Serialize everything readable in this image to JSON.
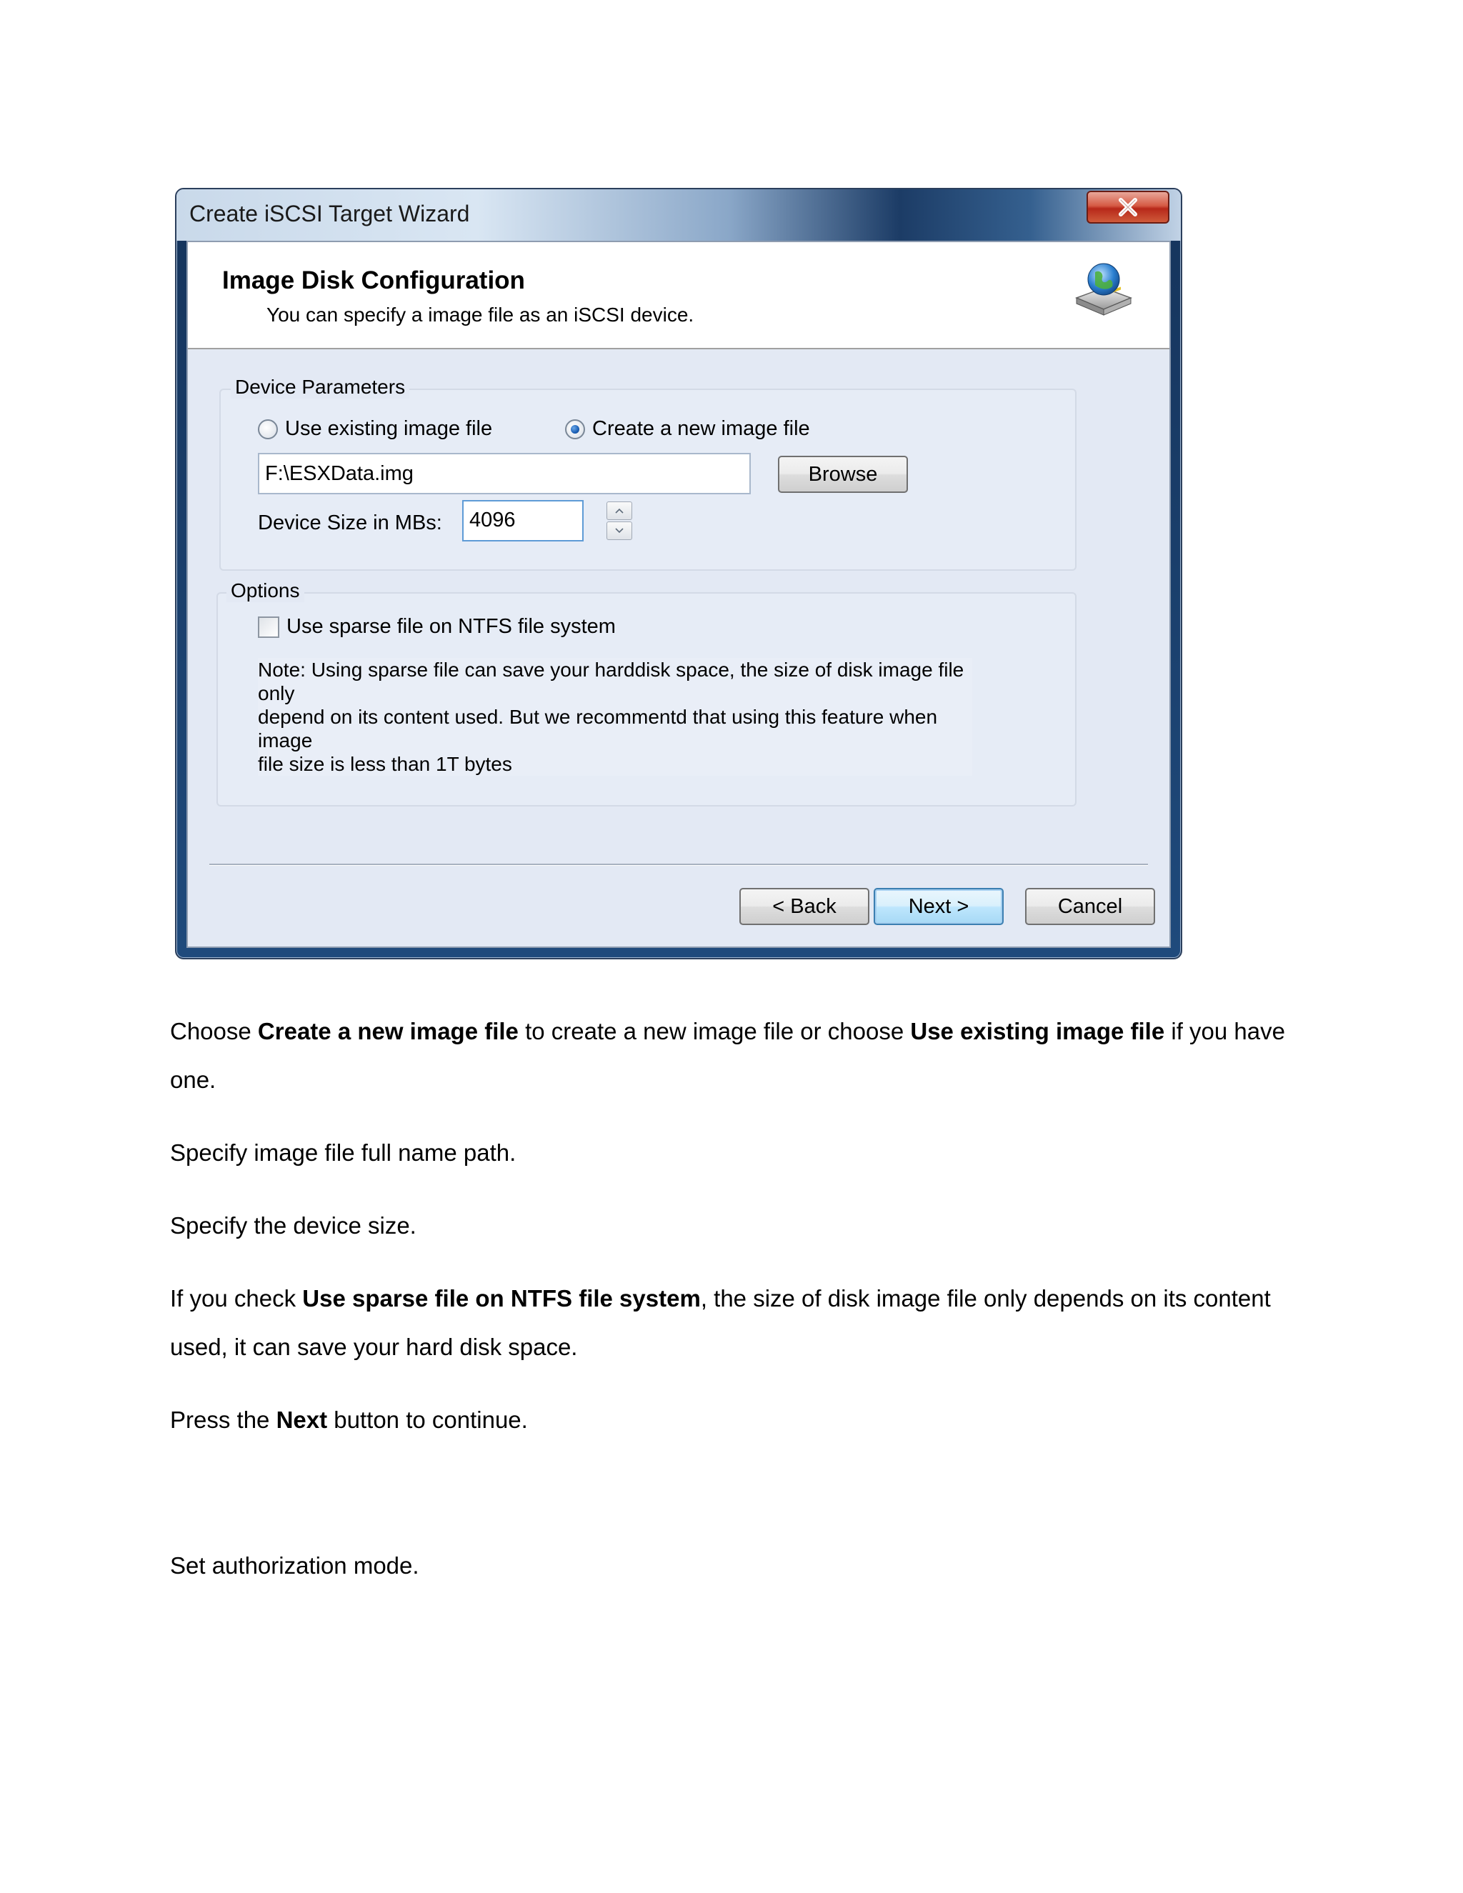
{
  "window": {
    "title": "Create iSCSI Target Wizard"
  },
  "header": {
    "title": "Image Disk Configuration",
    "subtitle": "You can specify a image file as an iSCSI device."
  },
  "device_parameters": {
    "legend": "Device Parameters",
    "radio_existing": "Use existing image file",
    "radio_new": "Create a new image file",
    "selected": "Create a new image file",
    "path_value": "F:\\ESXData.img",
    "browse_label": "Browse",
    "size_label": "Device Size in MBs:",
    "size_value": "4096"
  },
  "options": {
    "legend": "Options",
    "sparse_label": "Use sparse file on NTFS file system",
    "sparse_checked": false,
    "note_line1": "Note: Using sparse file can save your harddisk space, the size of disk image file only",
    "note_line2": "depend on its content used. But we recommentd that using this feature when image",
    "note_line3": "file size is less than 1T bytes"
  },
  "footer": {
    "back_label": "< Back",
    "next_label": "Next >",
    "cancel_label": "Cancel"
  },
  "document": {
    "p1_a": "Choose ",
    "p1_b": "Create a new image file",
    "p1_c": " to create a new image file or choose ",
    "p1_d": "Use existing image file",
    "p1_e": " if you have one.",
    "p2": "Specify image file full name path.",
    "p3": "Specify the device size.",
    "p4_a": "If you check ",
    "p4_b": "Use sparse file on NTFS file system",
    "p4_c": ", the size of disk image file only depends on its content used, it can save your hard disk space.",
    "p5_a": "Press the ",
    "p5_b": "Next",
    "p5_c": " button to continue.",
    "p6": "Set authorization mode."
  },
  "icons": {
    "close": "close-icon",
    "header": "disk-globe-icon"
  }
}
